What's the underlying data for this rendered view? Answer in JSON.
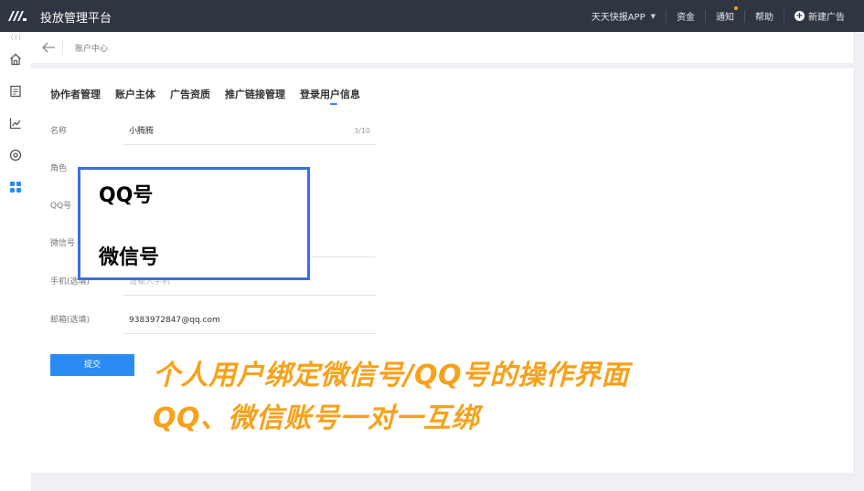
{
  "header": {
    "title": "投放管理平台",
    "app_selector": "天天快报APP",
    "funds": "资金",
    "notice": "通知",
    "help": "帮助",
    "new_ad": "新建广告"
  },
  "breadcrumb": {
    "current": "账户中心"
  },
  "tabs": [
    {
      "label": "协作者管理"
    },
    {
      "label": "账户主体"
    },
    {
      "label": "广告资质"
    },
    {
      "label": "推广链接管理"
    },
    {
      "label": "登录用户信息"
    }
  ],
  "form": {
    "name": {
      "label": "名称",
      "value": "小腾腾",
      "counter": "3/10"
    },
    "role": {
      "label": "角色"
    },
    "qq": {
      "label": "QQ号"
    },
    "wechat": {
      "label": "微信号"
    },
    "phone": {
      "label": "手机(选填)",
      "placeholder": "请输入手机"
    },
    "email": {
      "label": "邮箱(选填)",
      "value": "9383972847@qq.com"
    },
    "submit": "提交"
  },
  "overlay": {
    "line1": "QQ号",
    "line2": "微信号"
  },
  "caption": {
    "line1": "个人用户绑定微信号/QQ号的操作界面",
    "line2": "QQ、微信账号一对一互绑"
  },
  "colors": {
    "topbar": "#2f3541",
    "accent": "#2a8cf2",
    "caption": "#f7a11a",
    "overlay_border": "#3b6fe0"
  }
}
